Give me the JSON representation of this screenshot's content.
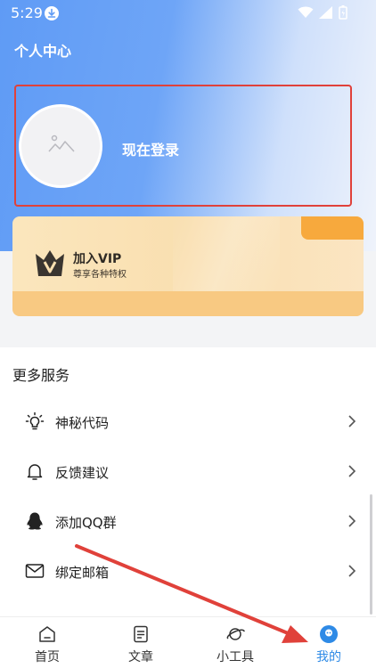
{
  "status_bar": {
    "time": "5:29"
  },
  "header": {
    "title": "个人中心"
  },
  "login": {
    "label": "现在登录"
  },
  "vip": {
    "title": "加入VIP",
    "subtitle": "尊享各种特权"
  },
  "services": {
    "title": "更多服务",
    "items": [
      {
        "label": "神秘代码",
        "icon": "lightbulb-icon"
      },
      {
        "label": "反馈建议",
        "icon": "bell-icon"
      },
      {
        "label": "添加QQ群",
        "icon": "qq-penguin-icon"
      },
      {
        "label": "绑定邮箱",
        "icon": "mail-icon"
      }
    ]
  },
  "tabbar": {
    "tabs": [
      {
        "label": "首页",
        "icon": "home-icon"
      },
      {
        "label": "文章",
        "icon": "document-icon"
      },
      {
        "label": "小工具",
        "icon": "planet-icon"
      },
      {
        "label": "我的",
        "icon": "profile-icon"
      }
    ],
    "active_index": 3
  },
  "colors": {
    "accent": "#2e8ae6",
    "header_gradient_start": "#5f9bf5",
    "highlight_border": "#e0413a",
    "vip_background": "#fbe6bd"
  }
}
